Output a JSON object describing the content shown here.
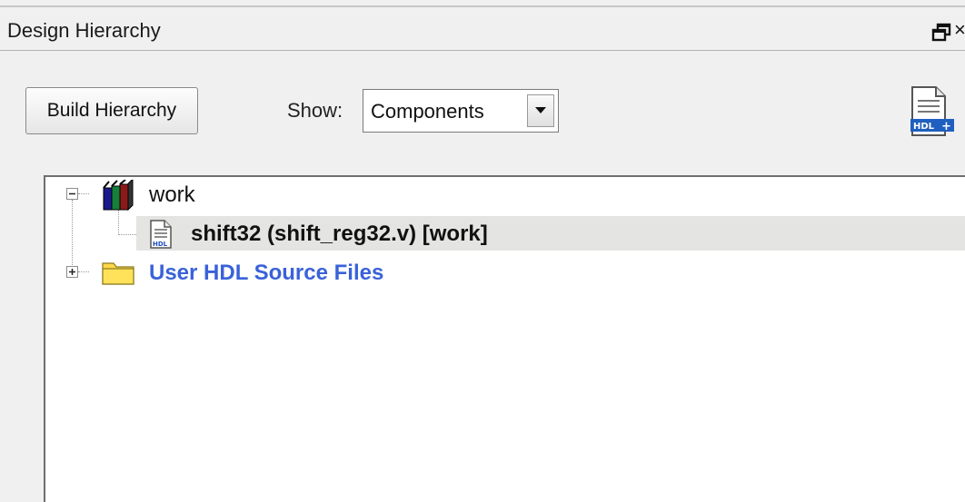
{
  "panel": {
    "title": "Design Hierarchy"
  },
  "toolbar": {
    "build_label": "Build Hierarchy",
    "show_label": "Show:",
    "show_value": "Components"
  },
  "tree": {
    "rows": [
      {
        "label": "work",
        "icon": "library-books-icon",
        "expander": "minus"
      },
      {
        "label": "shift32 (shift_reg32.v) [work]",
        "icon": "hdl-file-icon",
        "selected": true
      },
      {
        "label": "User HDL Source Files",
        "icon": "folder-icon",
        "expander": "plus",
        "color": "#3a62d8"
      }
    ]
  },
  "icons": {
    "restore": "restore-window-icon",
    "close": "close-icon",
    "new_hdl": "new-hdl-file-icon",
    "dropdown": "chevron-down-icon"
  },
  "colors": {
    "panel_bg": "#f0f0f0",
    "link_blue": "#3a62d8",
    "selection_bg": "#e4e4e2"
  }
}
